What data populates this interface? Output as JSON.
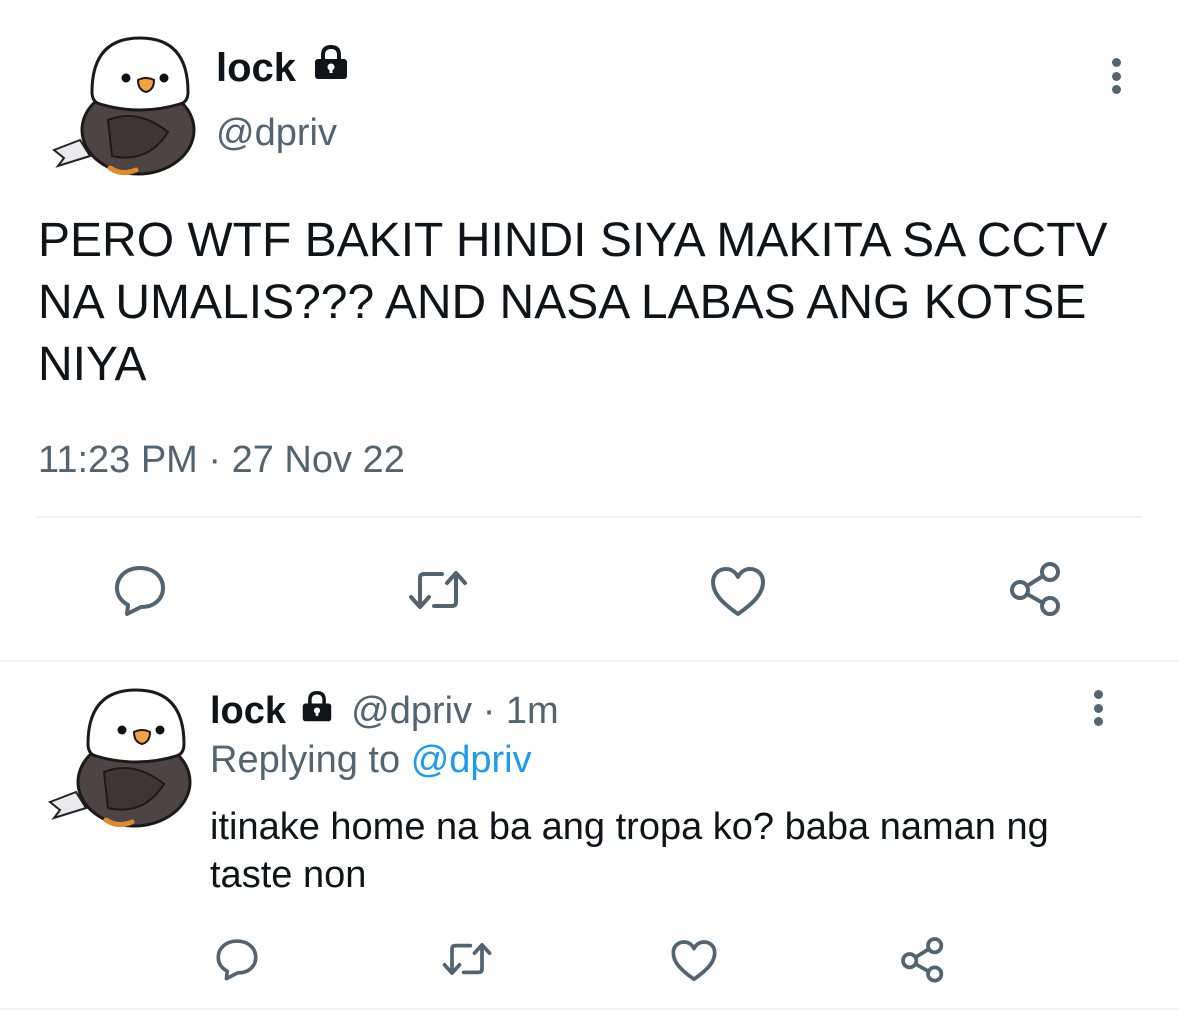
{
  "main_tweet": {
    "author_name": "lock",
    "handle": "@dpriv",
    "text": "PERO WTF BAKIT HINDI SIYA MAKITA SA CCTV NA UMALIS??? AND NASA LABAS ANG KOTSE NIYA",
    "timestamp": "11:23 PM · 27 Nov 22",
    "more_icon": "three-dots-vertical"
  },
  "reply_tweet": {
    "author_name": "lock",
    "handle": "@dpriv",
    "separator": "·",
    "age": "1m",
    "replying_prefix": "Replying to",
    "replying_handle": "@dpriv",
    "text": "itinake home na ba ang tropa ko? baba naman ng taste non",
    "more_icon": "three-dots-vertical"
  },
  "action_icons": [
    "reply-icon",
    "retweet-icon",
    "like-icon",
    "share-icon"
  ],
  "colors": {
    "text": "#0f1419",
    "muted": "#536471",
    "link": "#1d9bf0",
    "divider": "#eff3f4"
  }
}
